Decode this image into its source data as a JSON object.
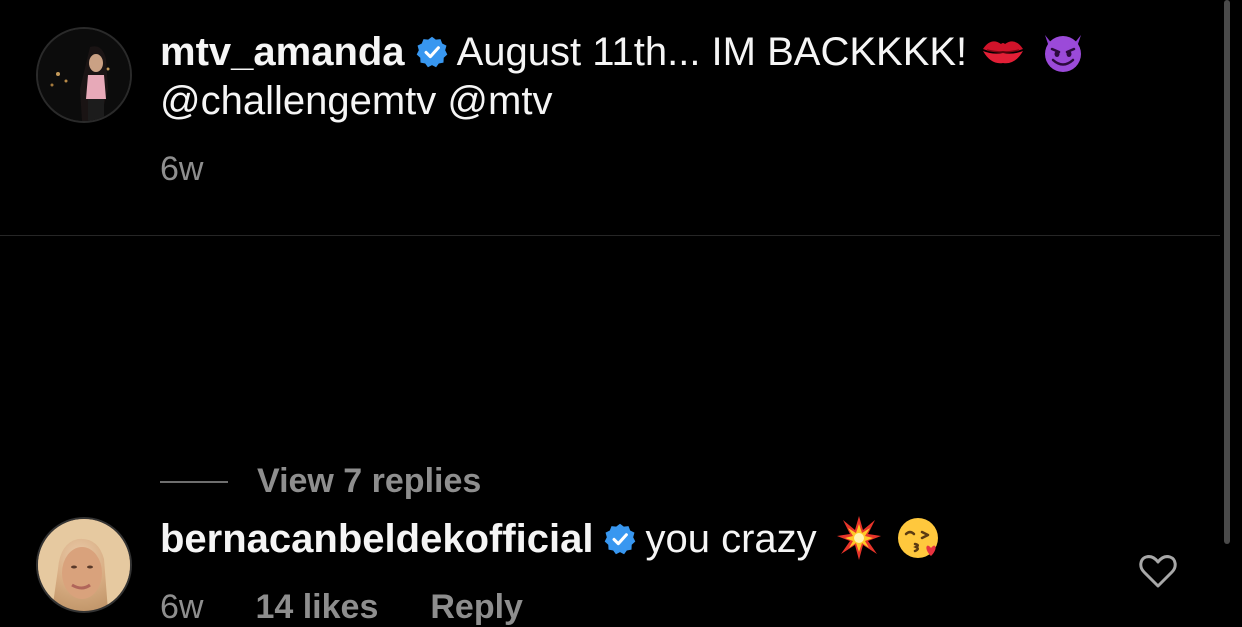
{
  "comments": [
    {
      "username": "mtv_amanda",
      "text": "August 11th... IM BACKKKK!",
      "mentions": "@challengemtv @mtv",
      "time": "6w",
      "emoji_icons": [
        "kiss-mark-icon",
        "smiling-devil-icon"
      ]
    },
    {
      "username": "bernacanbeldekofficial",
      "text": "you crazy",
      "time": "6w",
      "likes": "14 likes",
      "reply_label": "Reply",
      "view_replies": "View 7 replies",
      "emoji_icons": [
        "collision-icon",
        "kissing-face-icon"
      ]
    }
  ],
  "colors": {
    "background": "#000000",
    "primary_text": "#f5f5f5",
    "secondary_text": "#8e8e8e",
    "verified_blue": "#3897f0"
  }
}
